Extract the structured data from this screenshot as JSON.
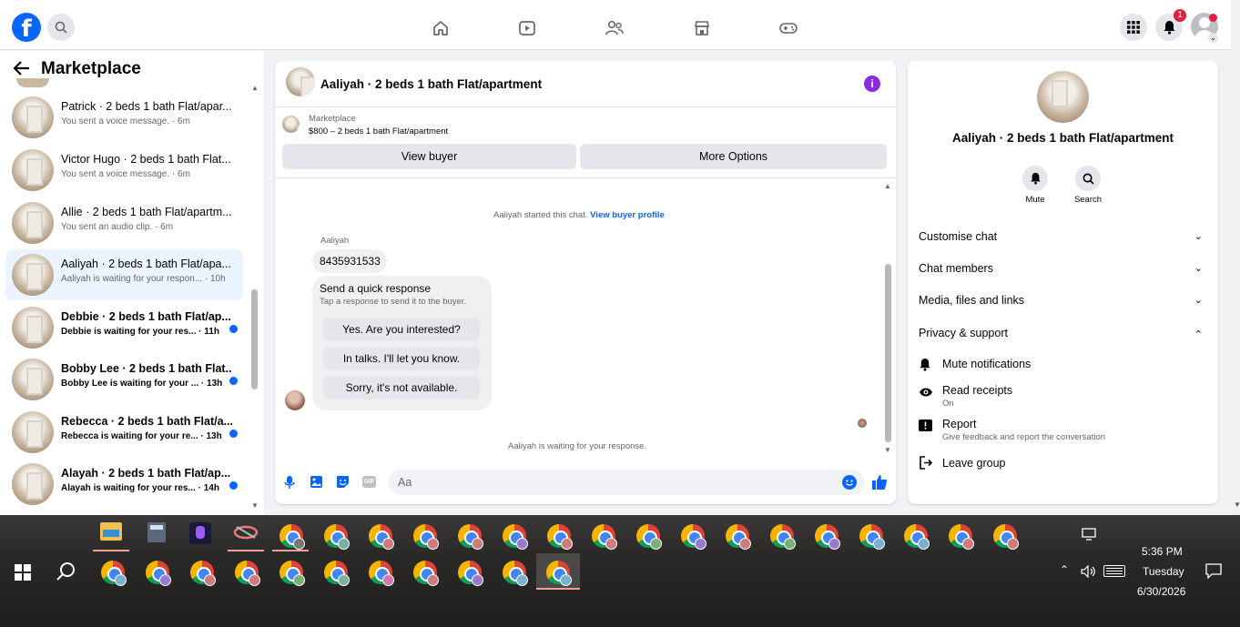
{
  "topnav": {
    "notification_count": "1",
    "icons": [
      "home-icon",
      "video-icon",
      "friends-icon",
      "marketplace-icon",
      "gaming-icon"
    ]
  },
  "sidebar": {
    "title": "Marketplace",
    "conversations": [
      {
        "title": "Patrick · 2 beds 1 bath Flat/apar...",
        "sub": "You sent a voice message. · 6m",
        "unread": false
      },
      {
        "title": "Victor Hugo · 2 beds 1 bath Flat...",
        "sub": "You sent a voice message. · 6m",
        "unread": false
      },
      {
        "title": "Allie · 2 beds 1 bath Flat/apartm...",
        "sub": "You sent an audio clip. · 6m",
        "unread": false
      },
      {
        "title": "Aaliyah · 2 beds 1 bath Flat/apa...",
        "sub": "Aaliyah is waiting for your respon... · 10h",
        "unread": false
      },
      {
        "title": "Debbie · 2 beds 1 bath Flat/ap...",
        "sub": "Debbie is waiting for your res... · 11h",
        "unread": true
      },
      {
        "title": "Bobby Lee · 2 beds 1 bath Flat...",
        "sub": "Bobby Lee is waiting for your ... · 13h",
        "unread": true
      },
      {
        "title": "Rebecca · 2 beds 1 bath Flat/a...",
        "sub": "Rebecca is waiting for your re... · 13h",
        "unread": true
      },
      {
        "title": "Alayah · 2 beds 1 bath Flat/ap...",
        "sub": "Alayah is waiting for your res... · 14h",
        "unread": true
      }
    ]
  },
  "chat": {
    "header_title": "Aaliyah · 2 beds 1 bath Flat/apartment",
    "listing_source": "Marketplace",
    "listing_price": "$800 – 2 beds 1 bath Flat/apartment",
    "view_buyer_label": "View buyer",
    "more_options_label": "More Options",
    "started_text": "Aaliyah started this chat.",
    "view_profile_link": "View buyer profile",
    "sender_name": "Aaliyah",
    "message": "8435931533",
    "quick_title": "Send a quick response",
    "quick_sub": "Tap a response to send it to the buyer.",
    "quick_replies": [
      "Yes. Are you interested?",
      "In talks. I'll let you know.",
      "Sorry, it's not available."
    ],
    "waiting_text": "Aaliyah is waiting for your response.",
    "composer_placeholder": "Aa"
  },
  "info": {
    "name": "Aaliyah · 2 beds 1 bath Flat/apartment",
    "mute_label": "Mute",
    "search_label": "Search",
    "sections": [
      "Customise chat",
      "Chat members",
      "Media, files and links",
      "Privacy & support"
    ],
    "privacy_items": [
      {
        "title": "Mute notifications",
        "sub": ""
      },
      {
        "title": "Read receipts",
        "sub": "On"
      },
      {
        "title": "Report",
        "sub": "Give feedback and report the conversation"
      },
      {
        "title": "Leave group",
        "sub": ""
      }
    ]
  },
  "taskbar": {
    "time": "5:36 PM",
    "day": "Tuesday",
    "date": "6/30/2026"
  },
  "colors": {
    "accent": "#0866ff",
    "purple_info": "#8a2be2",
    "unread_dot": "#0866ff"
  }
}
